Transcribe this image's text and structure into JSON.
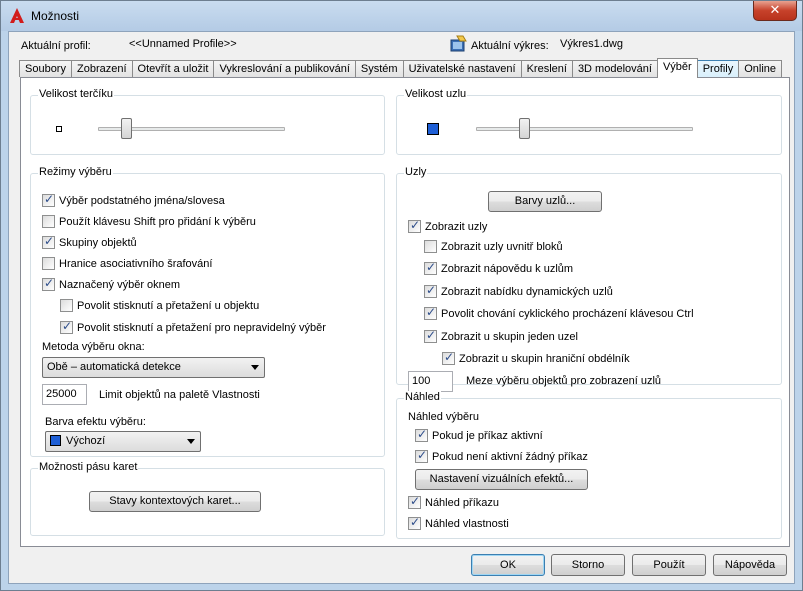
{
  "window": {
    "title": "Možnosti",
    "close_glyph": "✕"
  },
  "profile": {
    "label": "Aktuální profil:",
    "value": "<<Unnamed Profile>>"
  },
  "drawing": {
    "label": "Aktuální výkres:",
    "value": "Výkres1.dwg"
  },
  "tabs": [
    {
      "label": "Soubory"
    },
    {
      "label": "Zobrazení"
    },
    {
      "label": "Otevřít a uložit"
    },
    {
      "label": "Vykreslování a publikování"
    },
    {
      "label": "Systém"
    },
    {
      "label": "Uživatelské nastavení"
    },
    {
      "label": "Kreslení"
    },
    {
      "label": "3D modelování"
    },
    {
      "label": "Výběr"
    },
    {
      "label": "Profily"
    },
    {
      "label": "Online"
    }
  ],
  "pickbox": {
    "title": "Velikost terčíku",
    "slider_value": 0.15
  },
  "grip_size": {
    "title": "Velikost uzlu",
    "slider_value": 0.22
  },
  "selection_modes": {
    "title": "Režimy výběru",
    "noun_verb": "Výběr podstatného jména/slovesa",
    "shift_add": "Použít klávesu Shift pro přidání k výběru",
    "object_groups": "Skupiny objektů",
    "assoc_hatch": "Hranice asociativního šrafování",
    "implied_window": "Naznačený výběr oknem",
    "press_drag_object": "Povolit stisknutí a přetažení u objektu",
    "press_drag_lasso": "Povolit stisknutí a přetažení pro nepravidelný výběr",
    "window_method_label": "Metoda výběru okna:",
    "window_method_value": "Obě – automatická detekce",
    "object_limit_value": "25000",
    "object_limit_label": "Limit objektů na paletě Vlastnosti",
    "effect_color_label": "Barva efektu výběru:",
    "effect_color_value": "Výchozí"
  },
  "ribbon": {
    "title": "Možnosti pásu karet",
    "button": "Stavy kontextových karet..."
  },
  "grips": {
    "title": "Uzly",
    "colors_button": "Barvy uzlů...",
    "show_grips": "Zobrazit uzly",
    "within_blocks": "Zobrazit uzly uvnitř bloků",
    "grip_tips": "Zobrazit nápovědu k uzlům",
    "dynamic_menu": "Zobrazit nabídku dynamických uzlů",
    "ctrl_cycling": "Povolit chování cyklického procházení klávesou Ctrl",
    "single_grip_groups": "Zobrazit u skupin jeden uzel",
    "bbox_groups": "Zobrazit u skupin hraniční obdélník",
    "limit_value": "100",
    "limit_label": "Meze výběru objektů pro zobrazení uzlů"
  },
  "preview": {
    "title": "Náhled",
    "selection_preview": "Náhled výběru",
    "when_active": "Pokud je příkaz aktivní",
    "when_none": "Pokud není aktivní žádný příkaz",
    "visual_effects_button": "Nastavení vizuálních efektů...",
    "command_preview": "Náhled příkazu",
    "property_preview": "Náhled vlastnosti"
  },
  "footer": {
    "ok": "OK",
    "cancel": "Storno",
    "apply": "Použít",
    "help": "Nápověda"
  },
  "colors": {
    "accent": "#1e5fd6",
    "close": "#c7422b"
  }
}
